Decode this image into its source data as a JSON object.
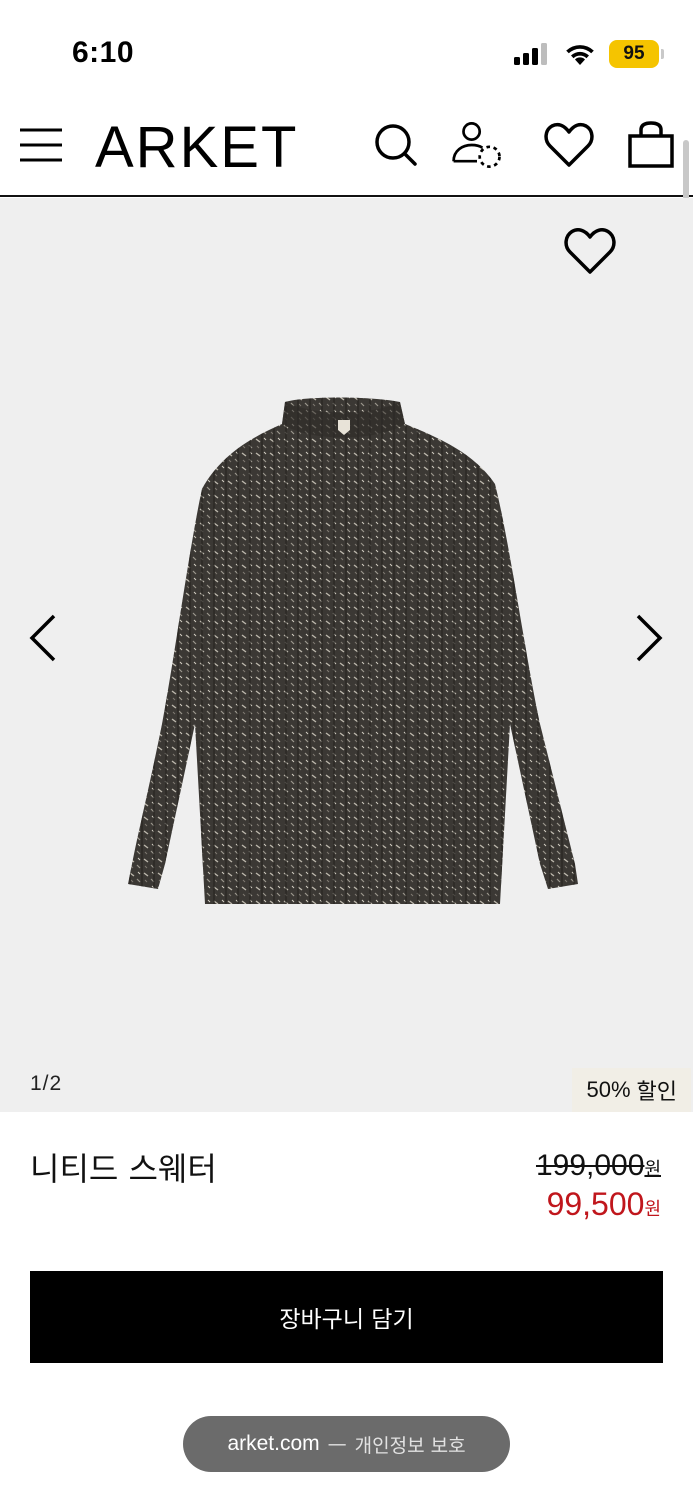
{
  "status_bar": {
    "time": "6:10",
    "battery": "95",
    "battery_color": "#f5c400"
  },
  "header": {
    "logo": "ARKET",
    "icons": [
      "menu-icon",
      "search-icon",
      "account-icon",
      "heart-icon",
      "shopping-bag-icon"
    ]
  },
  "gallery": {
    "counter": "1/2",
    "discount": "50%",
    "discount_label": "할인",
    "background": "#efefef"
  },
  "product": {
    "name": "니티드 스웨터",
    "original_price": "199,000",
    "sale_price": "99,500",
    "currency": "원",
    "sale_color": "#c0161c"
  },
  "cta": {
    "add_to_cart": "장바구니 담기"
  },
  "privacy": {
    "domain": "arket.com",
    "separator": "—",
    "label": "개인정보 보호"
  }
}
